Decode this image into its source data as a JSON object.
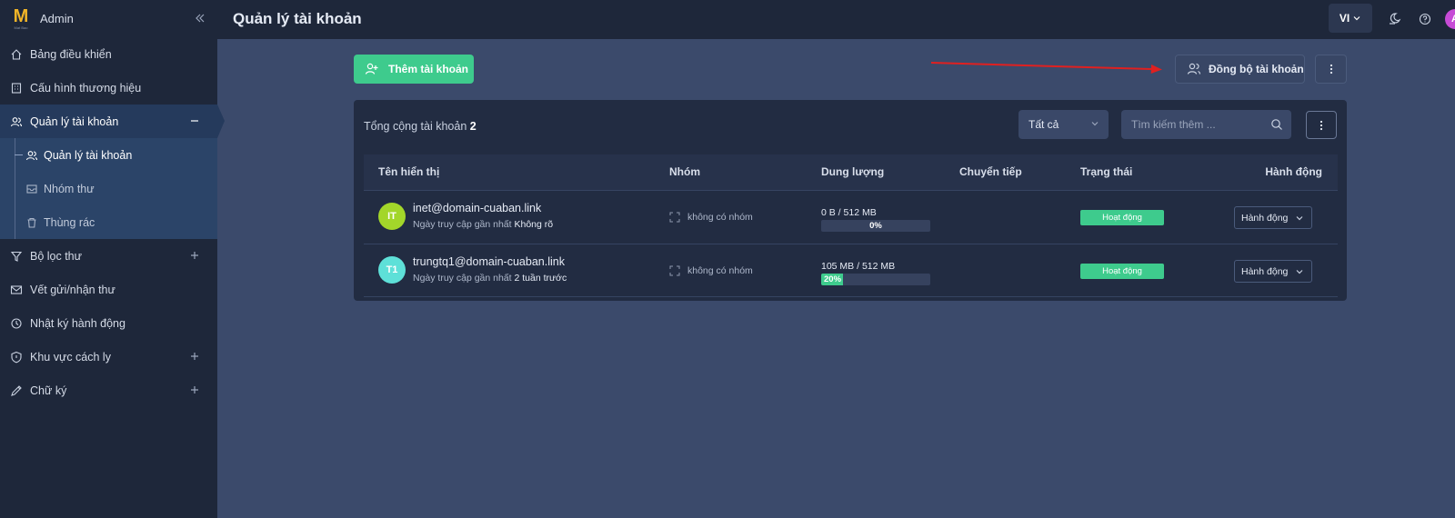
{
  "sidebar": {
    "brand": {
      "logo_letter": "M",
      "logo_sub": "Mat Bao",
      "name": "Admin"
    },
    "items": [
      {
        "label": "Bảng điều khiển",
        "icon": "home-icon"
      },
      {
        "label": "Cấu hình thương hiệu",
        "icon": "building-icon"
      },
      {
        "label": "Quản lý tài khoản",
        "icon": "users-icon",
        "active": true,
        "expanded": true
      },
      {
        "label": "Bộ lọc thư",
        "icon": "filter-icon"
      },
      {
        "label": "Vết gửi/nhận thư",
        "icon": "mail-icon"
      },
      {
        "label": "Nhật ký hành động",
        "icon": "history-icon"
      },
      {
        "label": "Khu vực cách ly",
        "icon": "shield-icon"
      },
      {
        "label": "Chữ ký",
        "icon": "signature-icon"
      }
    ],
    "subitems": [
      {
        "label": "Quản lý tài khoản",
        "icon": "users-icon",
        "active": true
      },
      {
        "label": "Nhóm thư",
        "icon": "inbox-icon"
      },
      {
        "label": "Thùng rác",
        "icon": "trash-icon"
      }
    ]
  },
  "header": {
    "title": "Quản lý tài khoản",
    "language": "VI",
    "user_initial": "A"
  },
  "toolbar": {
    "add_label": "Thêm tài khoản",
    "sync_label": "Đồng bộ tài khoản"
  },
  "card": {
    "total_label": "Tổng cộng tài khoản",
    "total_count": "2",
    "filter_value": "Tất cả",
    "search_placeholder": "Tìm kiếm thêm ..."
  },
  "table": {
    "columns": [
      "Tên hiển thị",
      "Nhóm",
      "Dung lượng",
      "Chuyển tiếp",
      "Trạng thái",
      "Hành động"
    ],
    "rows": [
      {
        "initials": "IT",
        "avatar_color": "#a3d62a",
        "email": "inet@domain-cuaban.link",
        "last_access_label": "Ngày truy cập gần nhất",
        "last_access_value": "Không rõ",
        "group": "không có nhóm",
        "quota": "0 B / 512 MB",
        "usage_percent": 0,
        "usage_label": "0%",
        "forwarding": "",
        "status": "Hoạt động",
        "action": "Hành động"
      },
      {
        "initials": "T1",
        "avatar_color": "#5ee0d8",
        "email": "trungtq1@domain-cuaban.link",
        "last_access_label": "Ngày truy cập gần nhất",
        "last_access_value": "2 tuần trước",
        "group": "không có nhóm",
        "quota": "105 MB / 512 MB",
        "usage_percent": 20,
        "usage_label": "20%",
        "forwarding": "",
        "status": "Hoạt động",
        "action": "Hành động"
      }
    ]
  },
  "colors": {
    "accent_green": "#3ecb8d",
    "sidebar_bg": "#1e273a",
    "content_bg": "#3b4a6b",
    "annotation_arrow": "#e02020"
  }
}
